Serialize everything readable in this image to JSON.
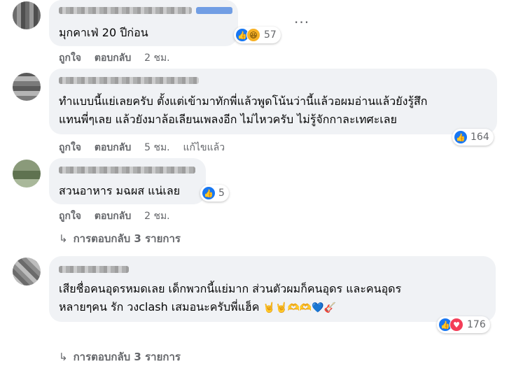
{
  "comments": [
    {
      "text_lines": [
        "มุกคาเฟ่ 20 ปีก่อน"
      ],
      "reaction_count": "57",
      "actions": {
        "like": "ถูกใจ",
        "reply": "ตอบกลับ",
        "time": "2 ชม."
      }
    },
    {
      "text_lines": [
        "ทำแบบนี้แย่เลยครับ ตั้งแต่เข้ามาทักพี่แล้วพูดโน้นว่านี้แล้วอผมอ่านแล้วยังรู้สึก",
        "แทนพี่ๆเลย แล้วยังมาล้อเลียนเพลงอีก ไม่ไหวครับ ไม่รู้จักกาละเทศะเลย"
      ],
      "reaction_count": "164",
      "actions": {
        "like": "ถูกใจ",
        "reply": "ตอบกลับ",
        "time": "5 ชม.",
        "edited": "แก้ไขแล้ว"
      }
    },
    {
      "text_lines": [
        "สวนอาหาร มฉผส แน่เลย"
      ],
      "reaction_count": "5",
      "actions": {
        "like": "ถูกใจ",
        "reply": "ตอบกลับ",
        "time": "2 ชม."
      },
      "replies_label": "การตอบกลับ 3 รายการ"
    },
    {
      "text_lines": [
        "เสียชื่อคนอุดรหมดเลย เด็กพวกนี้แย่มาก ส่วนตัวผมก็คนอุดร และคนอุดร",
        "หลายๆคน รัก วงclash เสมอนะครับพี่แฮ็ค"
      ],
      "emojis": [
        "🤘",
        "🤘",
        "🫶",
        "🫶",
        "💙",
        "🎸"
      ],
      "reaction_count": "176",
      "replies_label": "การตอบกลับ 3 รายการ"
    }
  ],
  "more_icon": "more-horizontal-icon"
}
